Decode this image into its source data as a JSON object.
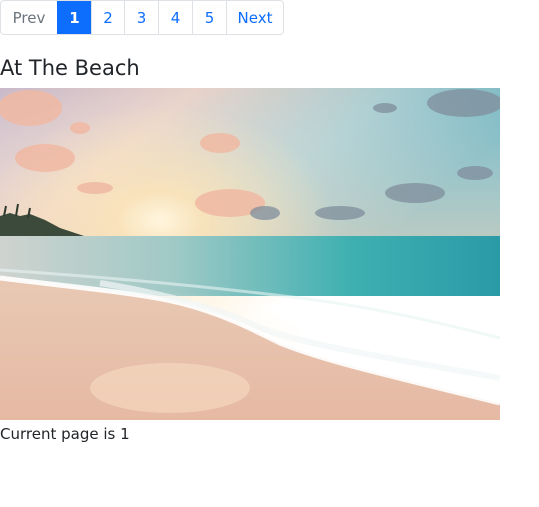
{
  "pagination": {
    "prev_label": "Prev",
    "pages": [
      "1",
      "2",
      "3",
      "4",
      "5"
    ],
    "next_label": "Next",
    "active_color": "#0d6efd",
    "link_color": "#0d6efd",
    "disabled_color": "#6c757d"
  },
  "photo": {
    "title": "At The Beach"
  },
  "status": {
    "current_page_text": "Current page is 1"
  }
}
